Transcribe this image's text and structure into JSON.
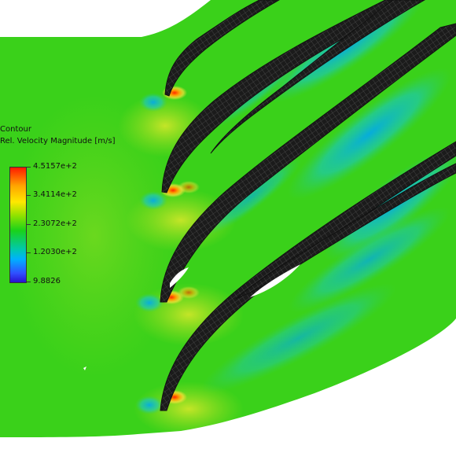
{
  "legend": {
    "title": "Contour",
    "variable": "Rel. Velocity Magnitude [m/s]",
    "ticks": [
      "4.5157e+2",
      "3.4114e+2",
      "2.3072e+2",
      "1.2030e+2",
      "9.8826"
    ],
    "colormap": [
      "#ff1a00",
      "#ffa500",
      "#ffe800",
      "#8fe200",
      "#19d21a",
      "#00c8b4",
      "#00b0ff",
      "#3050ff",
      "#2a10d0"
    ]
  },
  "field_colors": {
    "background": "#3ad11a",
    "stagnation": "#ff2a00",
    "acceleration": "#ffe13a",
    "wake": "#19c8d6",
    "blade": "#1b1b1b",
    "blade_mesh": "#5e5e5e"
  }
}
